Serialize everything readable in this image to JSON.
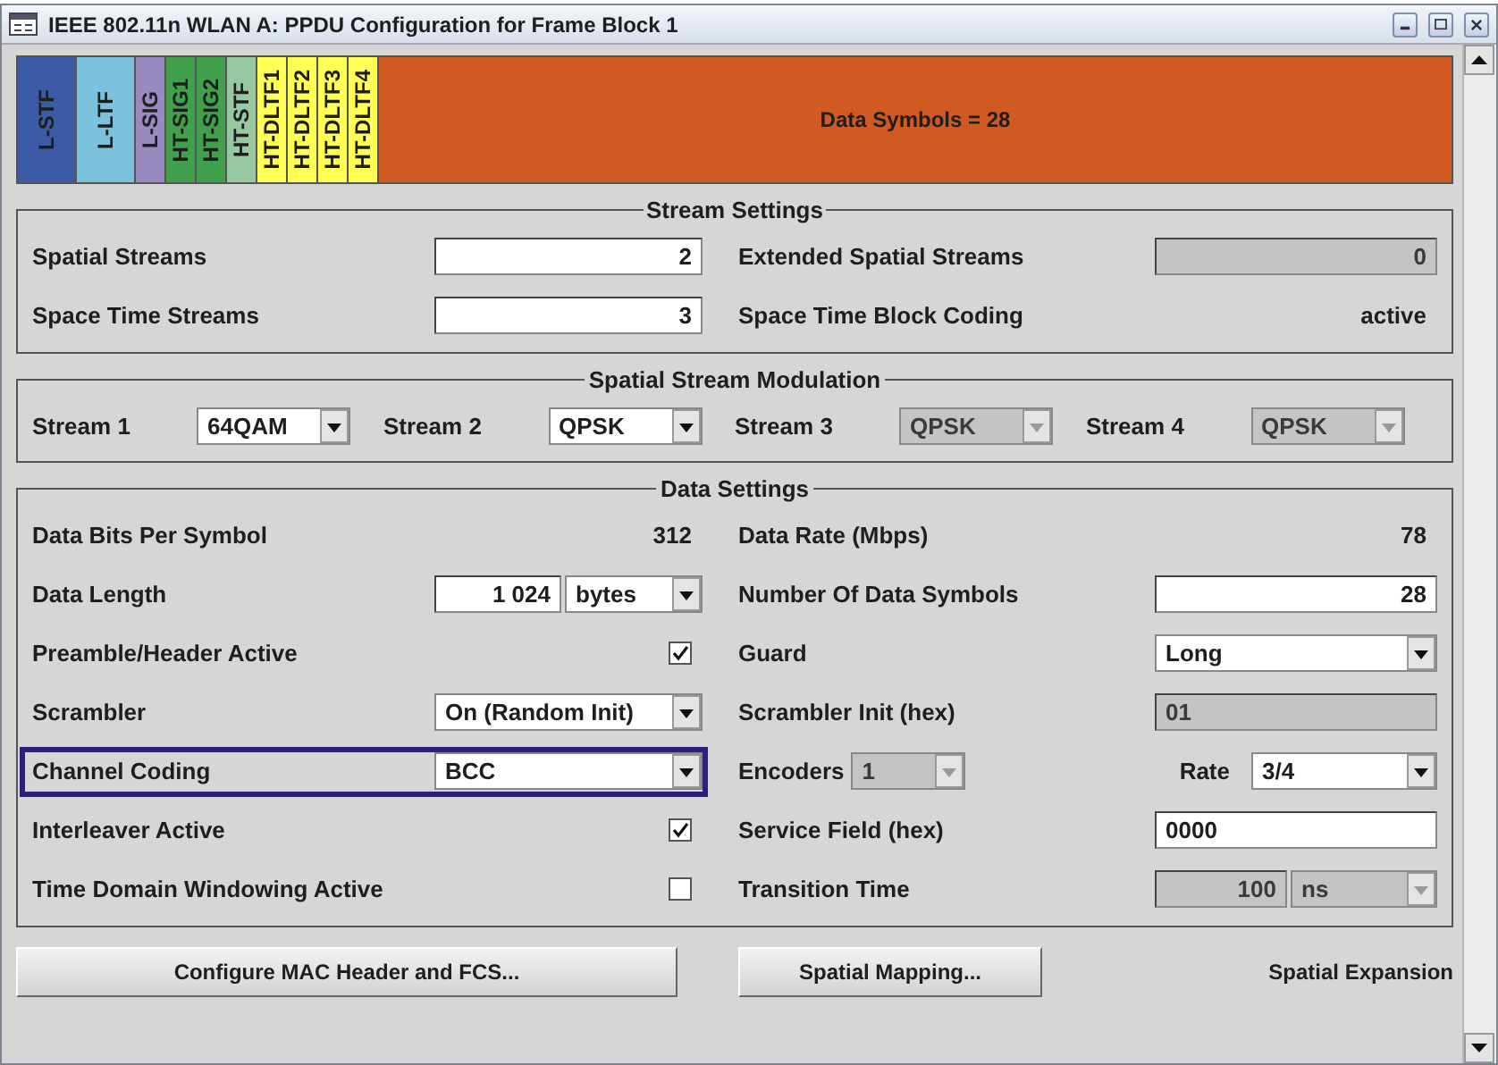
{
  "window": {
    "title": "IEEE 802.11n WLAN  A: PPDU Configuration for Frame Block 1"
  },
  "frame_blocks": [
    {
      "label": "L-STF",
      "color": "#3c5aa6",
      "kind": "training"
    },
    {
      "label": "L-LTF",
      "color": "#7cc2dc",
      "kind": "training"
    },
    {
      "label": "L-SIG",
      "color": "#9a8ac2",
      "kind": "field"
    },
    {
      "label": "HT-SIG1",
      "color": "#40a04c",
      "kind": "field"
    },
    {
      "label": "HT-SIG2",
      "color": "#40a04c",
      "kind": "field"
    },
    {
      "label": "HT-STF",
      "color": "#98c8a2",
      "kind": "field"
    },
    {
      "label": "HT-DLTF1",
      "color": "#ffff55",
      "kind": "field"
    },
    {
      "label": "HT-DLTF2",
      "color": "#ffff55",
      "kind": "field"
    },
    {
      "label": "HT-DLTF3",
      "color": "#ffff55",
      "kind": "field"
    },
    {
      "label": "HT-DLTF4",
      "color": "#ffff55",
      "kind": "field"
    },
    {
      "label": "Data Symbols = 28",
      "color": "#d05a22",
      "kind": "data"
    }
  ],
  "stream_settings": {
    "title": "Stream Settings",
    "rows": [
      {
        "left": {
          "label": "Spatial Streams",
          "control": {
            "kind": "input",
            "value": "2",
            "disabled": false
          }
        },
        "right": {
          "label": "Extended Spatial Streams",
          "control": {
            "kind": "input",
            "value": "0",
            "disabled": true
          }
        }
      },
      {
        "left": {
          "label": "Space Time Streams",
          "control": {
            "kind": "input",
            "value": "3",
            "disabled": false
          }
        },
        "right": {
          "label": "Space Time Block Coding",
          "control": {
            "kind": "readout",
            "value": "active"
          }
        }
      }
    ]
  },
  "modulation": {
    "title": "Spatial Stream Modulation",
    "streams": [
      {
        "label": "Stream 1",
        "value": "64QAM",
        "disabled": false
      },
      {
        "label": "Stream 2",
        "value": "QPSK",
        "disabled": false
      },
      {
        "label": "Stream 3",
        "value": "QPSK",
        "disabled": true
      },
      {
        "label": "Stream 4",
        "value": "QPSK",
        "disabled": true
      }
    ]
  },
  "data_settings": {
    "title": "Data Settings",
    "rows": [
      {
        "left": {
          "label": "Data Bits Per Symbol",
          "focused": false,
          "control": {
            "kind": "readout",
            "value": "312"
          }
        },
        "right": {
          "label": "Data Rate (Mbps)",
          "control": {
            "kind": "readout",
            "value": "78"
          }
        }
      },
      {
        "left": {
          "label": "Data Length",
          "focused": false,
          "control": {
            "kind": "input_unit",
            "value": "1 024",
            "unit": "bytes",
            "disabled": false
          }
        },
        "right": {
          "label": "Number Of Data Symbols",
          "control": {
            "kind": "input",
            "value": "28",
            "disabled": false
          }
        }
      },
      {
        "left": {
          "label": "Preamble/Header Active",
          "focused": false,
          "control": {
            "kind": "checkbox",
            "checked": true
          }
        },
        "right": {
          "label": "Guard",
          "control": {
            "kind": "select",
            "value": "Long",
            "disabled": false
          }
        }
      },
      {
        "left": {
          "label": "Scrambler",
          "focused": false,
          "control": {
            "kind": "select",
            "value": "On (Random Init)",
            "disabled": false
          }
        },
        "right": {
          "label": "Scrambler Init (hex)",
          "control": {
            "kind": "hex_input",
            "value": "01",
            "disabled": true
          }
        }
      },
      {
        "left": {
          "label": "Channel Coding",
          "focused": true,
          "control": {
            "kind": "select",
            "value": "BCC",
            "disabled": false
          }
        },
        "right": {
          "label": "Encoders",
          "control": {
            "kind": "encoders_rate",
            "value": "1",
            "disabled": true,
            "rate_label": "Rate",
            "rate": "3/4",
            "rate_disabled": false
          }
        }
      },
      {
        "left": {
          "label": "Interleaver Active",
          "focused": false,
          "control": {
            "kind": "checkbox",
            "checked": true
          }
        },
        "right": {
          "label": "Service Field (hex)",
          "control": {
            "kind": "hex_input",
            "value": "0000",
            "disabled": false
          }
        }
      },
      {
        "left": {
          "label": "Time Domain Windowing Active",
          "focused": false,
          "control": {
            "kind": "checkbox",
            "checked": false
          }
        },
        "right": {
          "label": "Transition Time",
          "control": {
            "kind": "input_unit",
            "value": "100",
            "unit": "ns",
            "disabled": true
          }
        }
      }
    ]
  },
  "buttons": [
    "Configure MAC Header and FCS...",
    "Spatial Mapping..."
  ],
  "spatial_mapping_mode": "Spatial Expansion"
}
